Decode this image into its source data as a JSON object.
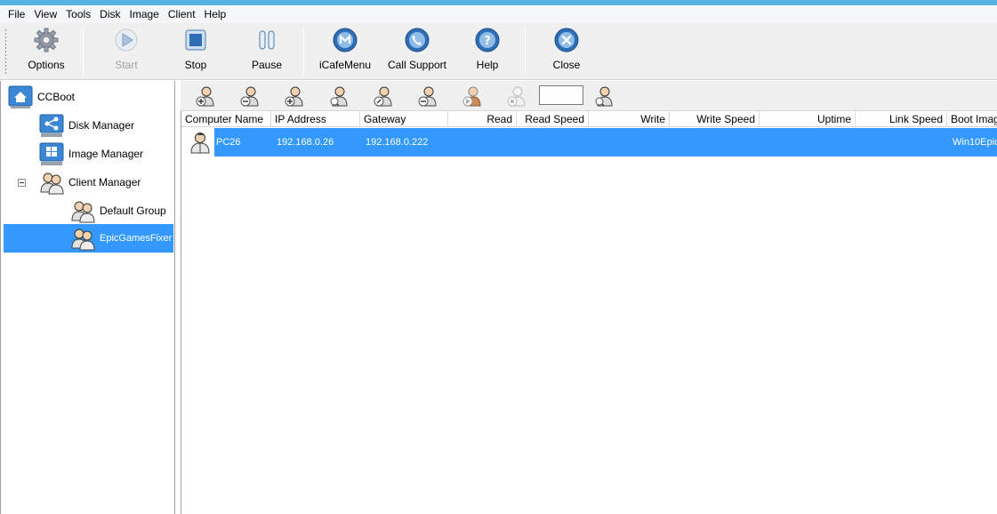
{
  "menu": [
    "File",
    "View",
    "Tools",
    "Disk",
    "Image",
    "Client",
    "Help"
  ],
  "toolbar": {
    "options": "Options",
    "start": "Start",
    "stop": "Stop",
    "pause": "Pause",
    "icafemenu": "iCafeMenu",
    "call_support": "Call Support",
    "help": "Help",
    "close": "Close"
  },
  "tree": {
    "root": "CCBoot",
    "disk_manager": "Disk Manager",
    "image_manager": "Image Manager",
    "client_manager": "Client Manager",
    "default_group": "Default Group",
    "selected_group": "EpicGamesFixer"
  },
  "columns": [
    "Computer Name",
    "IP Address",
    "Gateway",
    "Read",
    "Read Speed",
    "Write",
    "Write Speed",
    "Uptime",
    "Link Speed",
    "Boot Imag"
  ],
  "rows": [
    {
      "computer_name": "PC26",
      "ip_address": "192.168.0.26",
      "gateway": "192.168.0.222",
      "boot_image": "Win10Epic"
    }
  ],
  "colors": {
    "accent": "#3399ff",
    "title_strip": "#55b3e3",
    "toolbar_bg": "#f0f0f0"
  }
}
